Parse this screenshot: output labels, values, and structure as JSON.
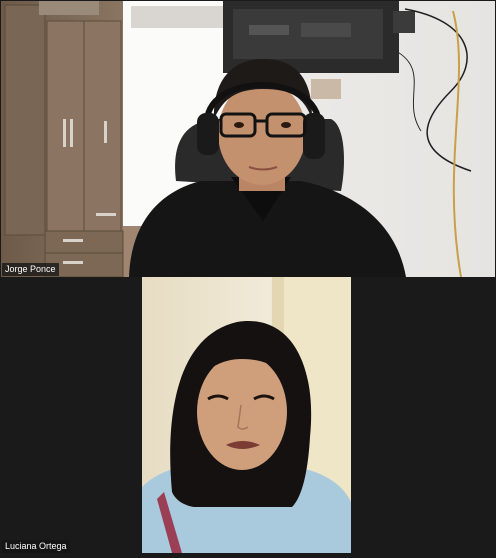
{
  "meeting": {
    "participants": [
      {
        "name": "Jorge Ponce",
        "video": "camera-on"
      },
      {
        "name": "Luciana Ortega",
        "video": "camera-on"
      }
    ]
  },
  "colors": {
    "tile_background": "#1a1a1a",
    "name_label_background": "rgba(20,20,20,0.78)",
    "name_label_text": "#ffffff"
  }
}
